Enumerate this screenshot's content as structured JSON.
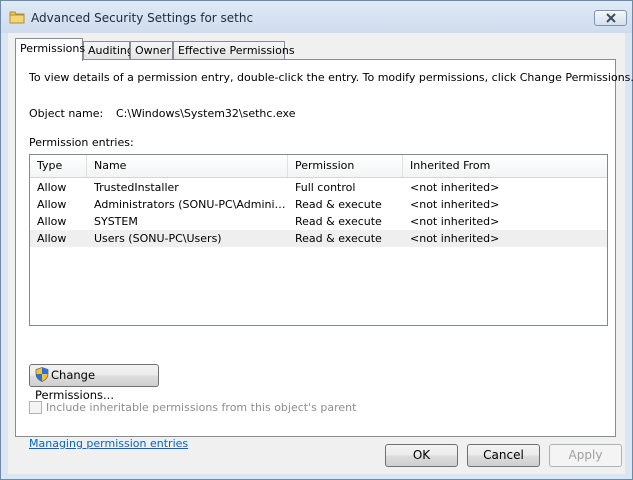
{
  "window": {
    "title": "Advanced Security Settings for sethc"
  },
  "tabs": [
    {
      "label": "Permissions",
      "active": true
    },
    {
      "label": "Auditing",
      "active": false
    },
    {
      "label": "Owner",
      "active": false
    },
    {
      "label": "Effective Permissions",
      "active": false
    }
  ],
  "permissions": {
    "instructions": "To view details of a permission entry, double-click the entry. To modify permissions, click Change Permissions.",
    "object_name_label": "Object name:",
    "object_name_value": "C:\\Windows\\System32\\sethc.exe",
    "entries_label": "Permission entries:",
    "columns": [
      "Type",
      "Name",
      "Permission",
      "Inherited From"
    ],
    "rows": [
      {
        "type": "Allow",
        "name": "TrustedInstaller",
        "permission": "Full control",
        "inherited": "<not inherited>"
      },
      {
        "type": "Allow",
        "name": "Administrators (SONU-PC\\Administrat...",
        "permission": "Read & execute",
        "inherited": "<not inherited>"
      },
      {
        "type": "Allow",
        "name": "SYSTEM",
        "permission": "Read & execute",
        "inherited": "<not inherited>"
      },
      {
        "type": "Allow",
        "name": "Users (SONU-PC\\Users)",
        "permission": "Read & execute",
        "inherited": "<not inherited>"
      }
    ],
    "change_button": "Change Permissions...",
    "inherit_checkbox": "Include inheritable permissions from this object's parent",
    "link": "Managing permission entries"
  },
  "footer": {
    "ok": "OK",
    "cancel": "Cancel",
    "apply": "Apply"
  },
  "icons": {
    "title": "folder-icon",
    "close": "close-icon",
    "shield": "uac-shield-icon"
  },
  "colors": {
    "link": "#0066cc",
    "selected_row": "#efefef"
  }
}
